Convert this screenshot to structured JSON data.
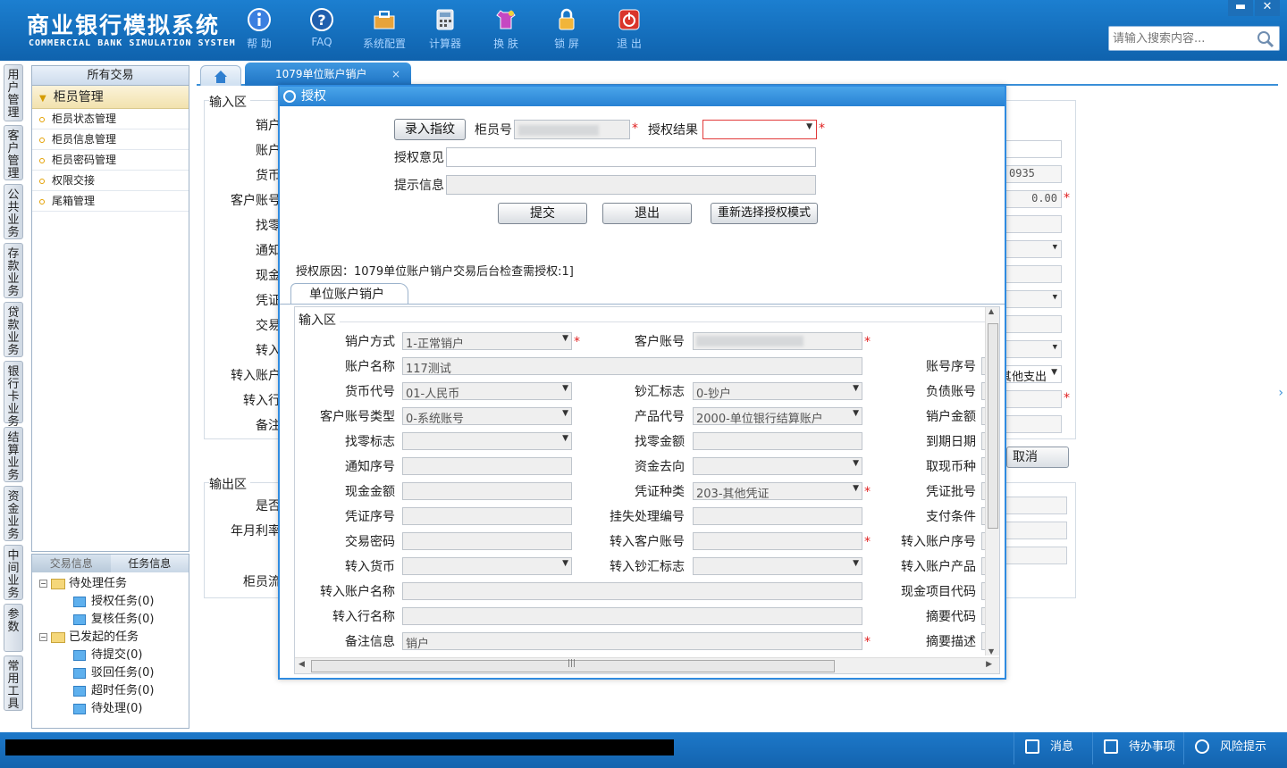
{
  "app": {
    "title_cn": "商业银行模拟系统",
    "title_en": "COMMERCIAL BANK SIMULATION SYSTEM"
  },
  "toolbar": [
    {
      "label": "帮 助",
      "icon": "info-icon"
    },
    {
      "label": "FAQ",
      "icon": "question-icon"
    },
    {
      "label": "系统配置",
      "icon": "toolbox-icon"
    },
    {
      "label": "计算器",
      "icon": "calculator-icon"
    },
    {
      "label": "换 肤",
      "icon": "shirt-icon"
    },
    {
      "label": "锁 屏",
      "icon": "lock-icon"
    },
    {
      "label": "退 出",
      "icon": "power-icon"
    }
  ],
  "window_controls": {
    "minimize": "▬",
    "close": "✕"
  },
  "search": {
    "placeholder": "请输入搜索内容..."
  },
  "vertical_nav": [
    "用户管理",
    "客户管理",
    "公共业务",
    "存款业务",
    "贷款业务",
    "银行卡业务",
    "结算业务",
    "资金业务",
    "中间业务",
    "参数",
    "常用工具"
  ],
  "left_panel": {
    "header": "所有交易",
    "group": "柜员管理",
    "items": [
      "柜员状态管理",
      "柜员信息管理",
      "柜员密码管理",
      "权限交接",
      "尾箱管理"
    ]
  },
  "task_panel": {
    "tabs": [
      "交易信息",
      "任务信息"
    ],
    "tree": {
      "pending": "待处理任务",
      "pending_children": [
        "授权任务(0)",
        "复核任务(0)"
      ],
      "initiated": "已发起的任务",
      "initiated_children": [
        "待提交(0)",
        "驳回任务(0)",
        "超时任务(0)",
        "待处理(0)"
      ]
    }
  },
  "tabs": {
    "active_label": "1079单位账户销户",
    "close": "×"
  },
  "background_form": {
    "input_section": "输入区",
    "output_section": "输出区",
    "labels": [
      "销户",
      "账户",
      "货币",
      "客户账号",
      "找零",
      "通知",
      "现金",
      "凭证",
      "交易",
      "转入",
      "转入账户",
      "转入行",
      "备注"
    ],
    "output_labels": [
      "是否",
      "年月利率",
      "柜员流"
    ],
    "values": {
      "code_tail": "0935",
      "amount": "0.00",
      "select_tail": "其他支出"
    },
    "cancel": "取消"
  },
  "dialog": {
    "title": "授权",
    "fingerprint_button": "录入指纹",
    "teller_label": "柜员号",
    "result_label": "授权结果",
    "opinion_label": "授权意见",
    "hint_label": "提示信息",
    "submit": "提交",
    "exit": "退出",
    "reselect": "重新选择授权模式",
    "reason": "授权原因：1079单位账户销户交易后台检查需授权:1]",
    "inner_tab": "单位账户销户",
    "inner_section": "输入区",
    "rows": [
      {
        "l1": "销户方式",
        "v1": "1-正常销户",
        "l2": "客户账号",
        "v2": "",
        "l3": ""
      },
      {
        "l1": "账户名称",
        "v1": "117测试",
        "l2": "",
        "v2": "",
        "l3": "账号序号"
      },
      {
        "l1": "货币代号",
        "v1": "01-人民币",
        "l2": "钞汇标志",
        "v2": "0-钞户",
        "l3": "负债账号"
      },
      {
        "l1": "客户账号类型",
        "v1": "0-系统账号",
        "l2": "产品代号",
        "v2": "2000-单位银行结算账户",
        "l3": "销户金额"
      },
      {
        "l1": "找零标志",
        "v1": "",
        "l2": "找零金额",
        "v2": "",
        "l3": "到期日期"
      },
      {
        "l1": "通知序号",
        "v1": "",
        "l2": "资金去向",
        "v2": "",
        "l3": "取现币种"
      },
      {
        "l1": "现金金额",
        "v1": "",
        "l2": "凭证种类",
        "v2": "203-其他凭证",
        "l3": "凭证批号"
      },
      {
        "l1": "凭证序号",
        "v1": "",
        "l2": "挂失处理编号",
        "v2": "",
        "l3": "支付条件"
      },
      {
        "l1": "交易密码",
        "v1": "",
        "l2": "转入客户账号",
        "v2": "",
        "l3": "转入账户序号"
      },
      {
        "l1": "转入货币",
        "v1": "",
        "l2": "转入钞汇标志",
        "v2": "",
        "l3": "转入账户产品"
      },
      {
        "l1": "转入账户名称",
        "v1": "",
        "l2": "",
        "v2": "",
        "l3": "现金项目代码"
      },
      {
        "l1": "转入行名称",
        "v1": "",
        "l2": "",
        "v2": "",
        "l3": "摘要代码"
      },
      {
        "l1": "备注信息",
        "v1": "销户",
        "l2": "",
        "v2": "",
        "l3": "摘要描述"
      }
    ]
  },
  "statusbar": {
    "messages": "消息",
    "todo": "待办事项",
    "risk": "风险提示"
  },
  "colors": {
    "header": "#1c7fd0",
    "accent": "#2f8be0",
    "required": "#e01e1e"
  }
}
